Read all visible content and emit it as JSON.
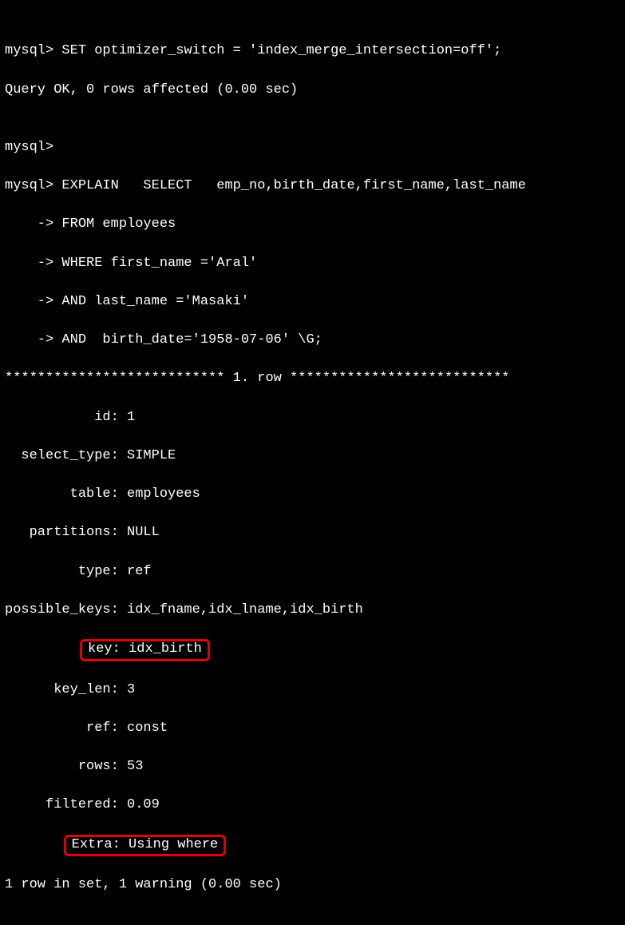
{
  "lines": {
    "l1": "mysql> SET optimizer_switch = 'index_merge_intersection=off';",
    "l2": "Query OK, 0 rows affected (0.00 sec)",
    "l3": "",
    "l4": "mysql>",
    "l5": "mysql> EXPLAIN   SELECT   emp_no,birth_date,first_name,last_name",
    "l6": "    -> FROM employees",
    "l7": "    -> WHERE first_name ='Aral'",
    "l8": "    -> AND last_name ='Masaki'",
    "l9": "    -> AND  birth_date='1958-07-06' \\G;",
    "l10": "*************************** 1. row ***************************",
    "l11": "           id: 1",
    "l12": "  select_type: SIMPLE",
    "l13": "        table: employees",
    "l14": "   partitions: NULL",
    "l15": "         type: ref",
    "l16": "possible_keys: idx_fname,idx_lname,idx_birth",
    "l17_prefix": "          ",
    "l17_box": "key: idx_birth",
    "l18": "      key_len: 3",
    "l19": "          ref: const",
    "l20": "         rows: 53",
    "l21": "     filtered: 0.09",
    "l22_prefix": "        ",
    "l22_box": "Extra: Using where",
    "l23": "1 row in set, 1 warning (0.00 sec)"
  }
}
